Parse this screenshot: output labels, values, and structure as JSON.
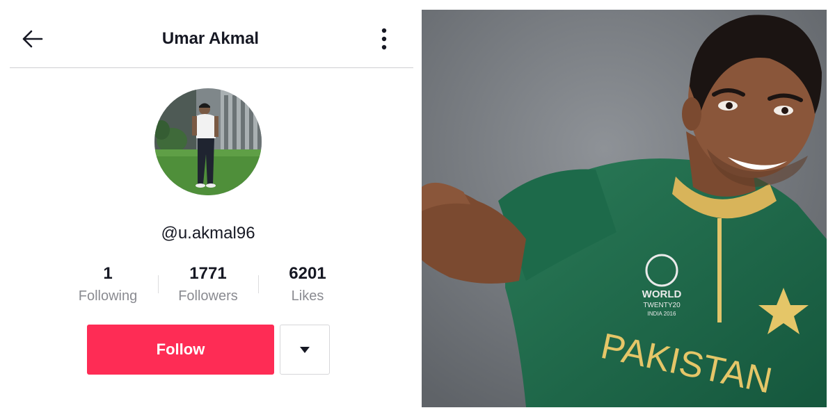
{
  "profile": {
    "title": "Umar Akmal",
    "handle": "@u.akmal96",
    "stats": [
      {
        "value": "1",
        "label": "Following"
      },
      {
        "value": "1771",
        "label": "Followers"
      },
      {
        "value": "6201",
        "label": "Likes"
      }
    ],
    "follow_label": "Follow"
  },
  "icons": {
    "back": "arrow-left-icon",
    "more": "vertical-dots-icon",
    "dropdown": "caret-down-icon"
  },
  "photo": {
    "jersey_text": "PAKISTAN",
    "badge_line1": "WORLD",
    "badge_line2": "TWENTY20",
    "badge_line3": "INDIA 2016"
  },
  "colors": {
    "accent": "#fe2c55",
    "jersey": "#1f6d4d"
  }
}
